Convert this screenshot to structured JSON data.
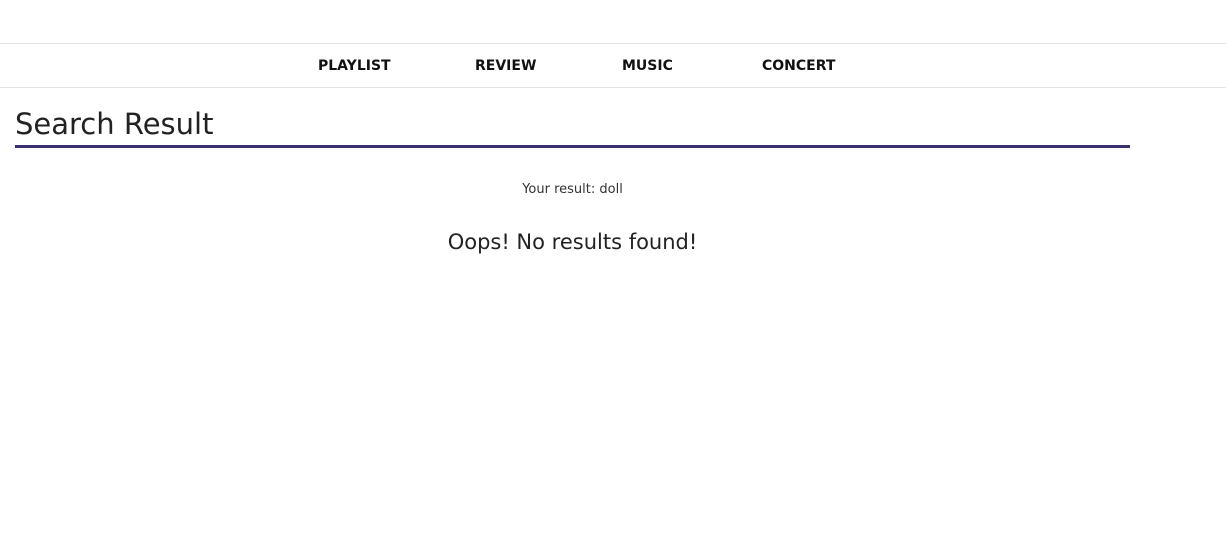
{
  "nav": {
    "items": [
      {
        "label": "PLAYLIST"
      },
      {
        "label": "REVIEW"
      },
      {
        "label": "MUSIC"
      },
      {
        "label": "CONCERT"
      }
    ]
  },
  "page": {
    "title": "Search Result",
    "result_prefix": "Your result: ",
    "query": "doll",
    "empty_message": "Oops! No results found!"
  },
  "colors": {
    "title_underline": "#3b2f73",
    "border": "#e3e3e3"
  }
}
